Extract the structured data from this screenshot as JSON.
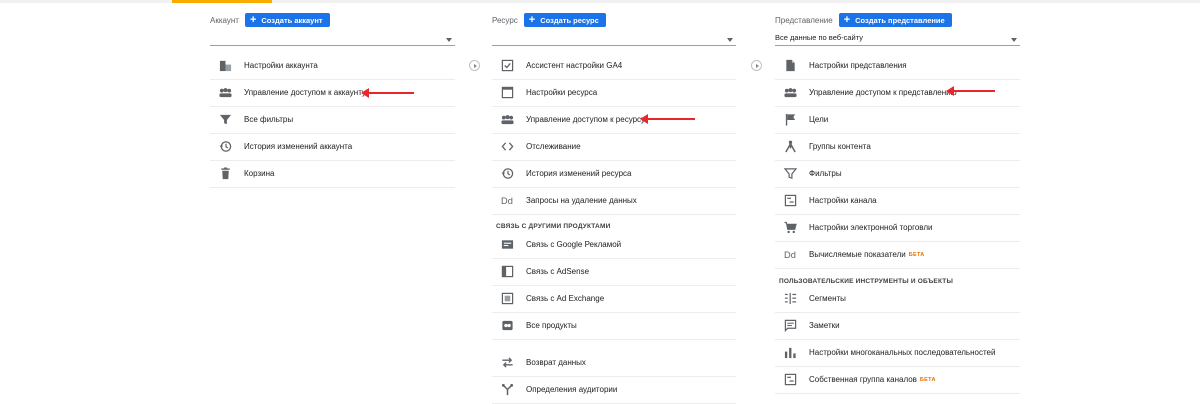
{
  "account": {
    "label": "Аккаунт",
    "create_label": "Создать аккаунт",
    "selector_value": "",
    "items": [
      {
        "label": "Настройки аккаунта",
        "icon": "building-icon"
      },
      {
        "label": "Управление доступом к аккаунту",
        "icon": "people-icon"
      },
      {
        "label": "Все фильтры",
        "icon": "filter-icon"
      },
      {
        "label": "История изменений аккаунта",
        "icon": "history-icon"
      },
      {
        "label": "Корзина",
        "icon": "trash-icon"
      }
    ]
  },
  "property": {
    "label": "Ресурс",
    "create_label": "Создать ресурс",
    "selector_value": "",
    "items": [
      {
        "label": "Ассистент настройки GA4",
        "icon": "checkbox-icon"
      },
      {
        "label": "Настройки ресурса",
        "icon": "window-icon"
      },
      {
        "label": "Управление доступом к ресурсу",
        "icon": "people-icon"
      },
      {
        "label": "Отслеживание",
        "icon": "code-icon"
      },
      {
        "label": "История изменений ресурса",
        "icon": "history-icon"
      },
      {
        "label": "Запросы на удаление данных",
        "icon": "dd-icon"
      }
    ],
    "section_title": "СВЯЗЬ С ДРУГИМИ ПРОДУКТАМИ",
    "links": [
      {
        "label": "Связь с Google Рекламой",
        "icon": "ads-icon"
      },
      {
        "label": "Связь с AdSense",
        "icon": "adsense-icon"
      },
      {
        "label": "Связь с Ad Exchange",
        "icon": "adexchange-icon"
      },
      {
        "label": "Все продукты",
        "icon": "link-icon"
      },
      {
        "label": "Возврат данных",
        "icon": "data-return-icon"
      },
      {
        "label": "Определения аудитории",
        "icon": "audience-icon"
      }
    ]
  },
  "view": {
    "label": "Представление",
    "create_label": "Создать представление",
    "selector_value": "Все данные по веб-сайту",
    "items": [
      {
        "label": "Настройки представления",
        "icon": "document-icon"
      },
      {
        "label": "Управление доступом к представлению",
        "icon": "people-icon"
      },
      {
        "label": "Цели",
        "icon": "flag-icon"
      },
      {
        "label": "Группы контента",
        "icon": "content-groups-icon"
      },
      {
        "label": "Фильтры",
        "icon": "filter-icon"
      },
      {
        "label": "Настройки канала",
        "icon": "channel-icon"
      },
      {
        "label": "Настройки электронной торговли",
        "icon": "cart-icon"
      },
      {
        "label": "Вычисляемые показатели",
        "icon": "dd-icon",
        "badge": "БЕТА"
      }
    ],
    "section_title": "ПОЛЬЗОВАТЕЛЬСКИЕ ИНСТРУМЕНТЫ И ОБЪЕКТЫ",
    "tools": [
      {
        "label": "Сегменты",
        "icon": "segments-icon"
      },
      {
        "label": "Заметки",
        "icon": "notes-icon"
      },
      {
        "label": "Настройки многоканальных последовательностей",
        "icon": "bar-chart-icon"
      },
      {
        "label": "Собственная группа каналов",
        "icon": "channel-icon",
        "badge": "БЕТА"
      }
    ]
  },
  "colors": {
    "accent": "#1a73e8",
    "annotation_arrow": "#e8262b",
    "beta": "#e37400",
    "tab_indicator": "#f9ab00"
  }
}
